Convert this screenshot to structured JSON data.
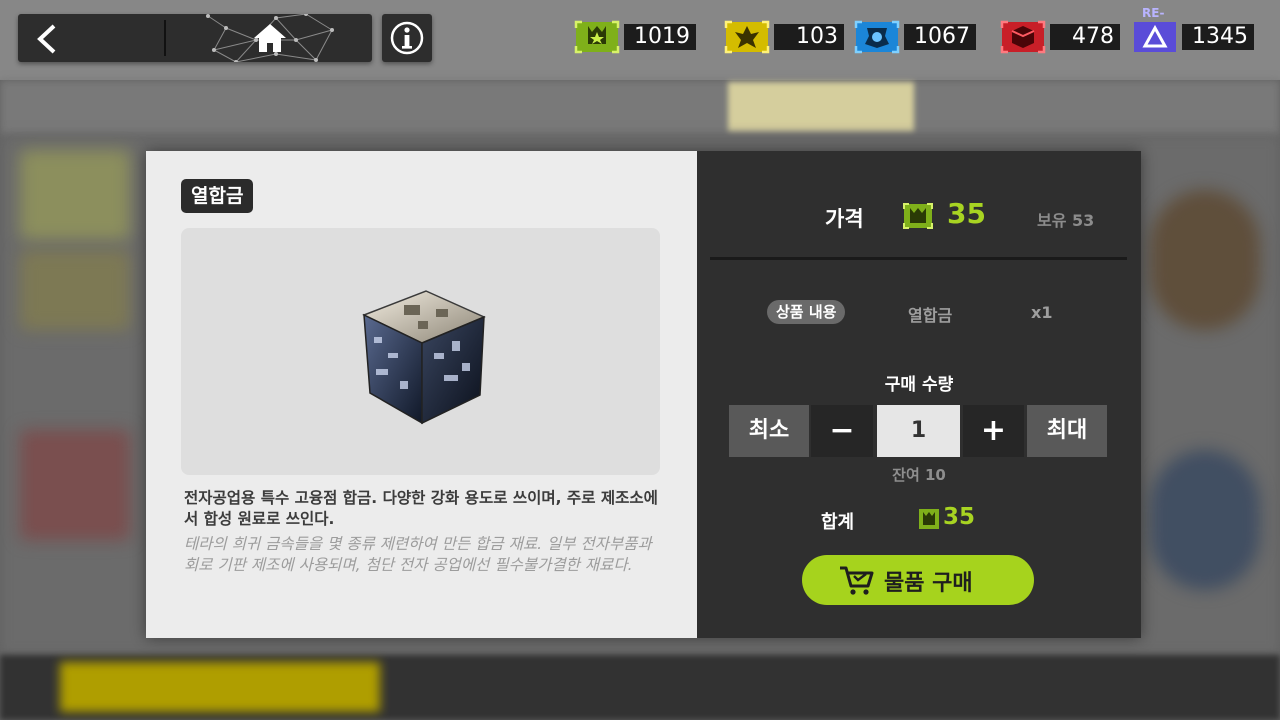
{
  "currencies": [
    {
      "name": "green-currency",
      "value": "1019",
      "color": "#9bd21c"
    },
    {
      "name": "yellow-currency",
      "value": "103",
      "color": "#e8d000"
    },
    {
      "name": "blue-currency",
      "value": "1067",
      "color": "#1f9ef0"
    },
    {
      "name": "red-currency",
      "value": "478",
      "color": "#e22b33"
    },
    {
      "name": "purple-currency",
      "value": "1345",
      "color": "#6b5cf0",
      "tag": "RE-"
    }
  ],
  "item": {
    "title": "열합금",
    "description": "전자공업용 특수 고융점 합금. 다양한 강화 용도로 쓰이며, 주로 제조소에서 합성 원료로 쓰인다.",
    "flavor": "테라의 희귀 금속들을 몇 종류 제련하여 만든 합금 재료. 일부 전자부품과 회로 기판 제조에 사용되며, 첨단 전자 공업에선 필수불가결한 재료다."
  },
  "purchase": {
    "price_label": "가격",
    "price": "35",
    "owned": "보유 53",
    "content_badge": "상품 내용",
    "content_name": "열합금",
    "content_qty": "x1",
    "qty_label": "구매 수량",
    "min_label": "최소",
    "minus_label": "−",
    "quantity": "1",
    "plus_label": "+",
    "max_label": "최대",
    "remaining": "잔여 10",
    "total_label": "합계",
    "total": "35",
    "buy_label": "물품 구매"
  },
  "colors": {
    "accent": "#a6d31d"
  }
}
